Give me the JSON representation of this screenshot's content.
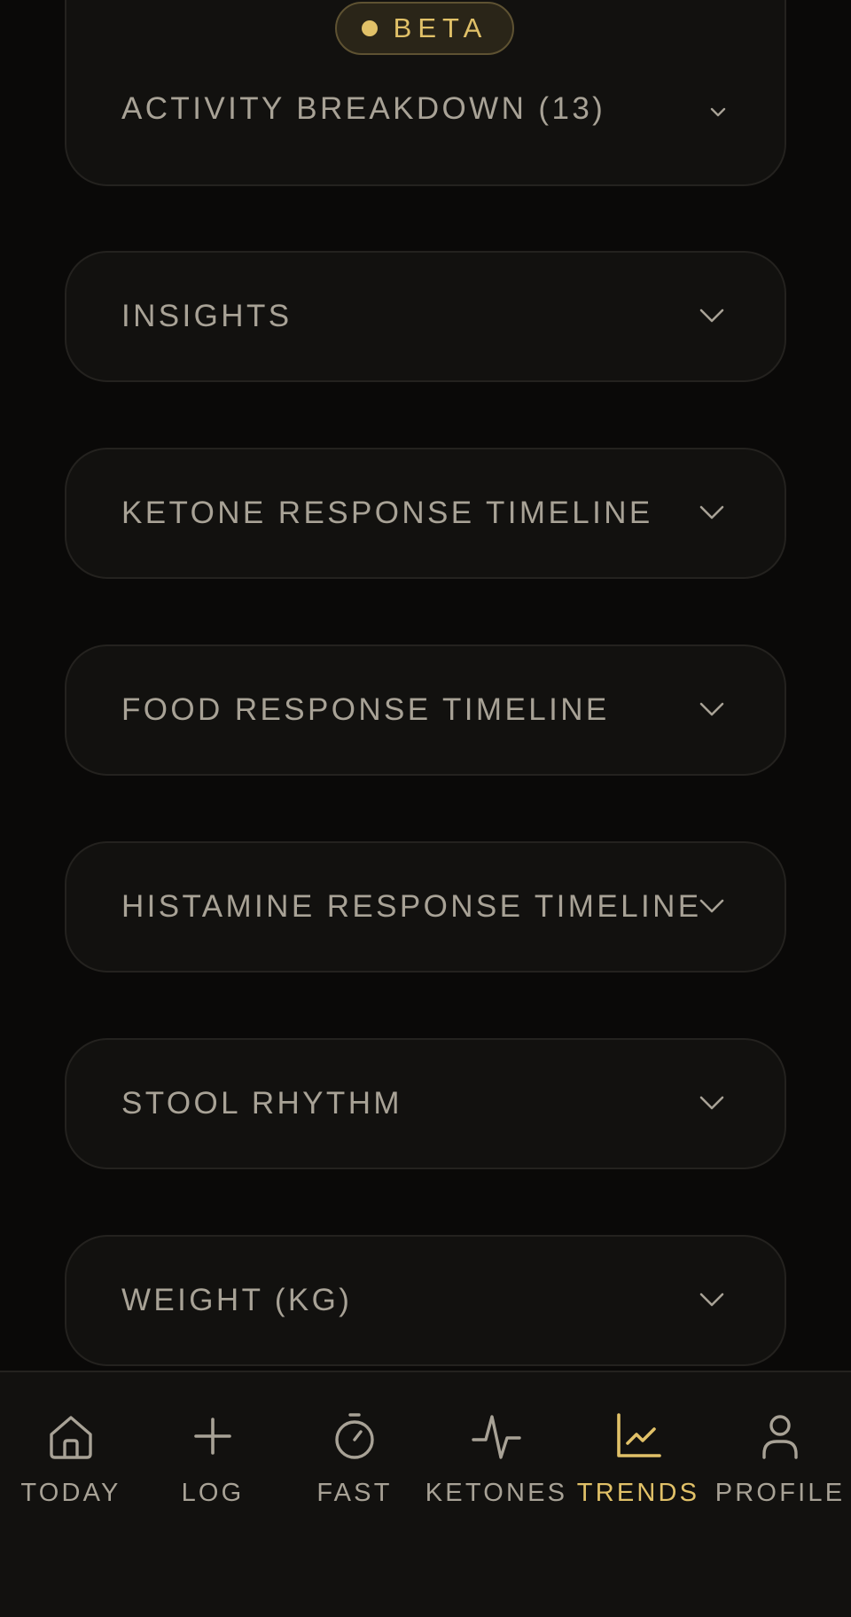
{
  "badge": {
    "label": "BETA"
  },
  "sections": [
    {
      "title": "ACTIVITY BREAKDOWN (13)"
    },
    {
      "title": "INSIGHTS"
    },
    {
      "title": "KETONE RESPONSE TIMELINE"
    },
    {
      "title": "FOOD RESPONSE TIMELINE"
    },
    {
      "title": "HISTAMINE RESPONSE TIMELINE"
    },
    {
      "title": "STOOL RHYTHM"
    },
    {
      "title": "WEIGHT (KG)"
    }
  ],
  "nav": {
    "active": "trends",
    "items": [
      {
        "id": "today",
        "label": "TODAY",
        "icon": "home-icon"
      },
      {
        "id": "log",
        "label": "LOG",
        "icon": "plus-icon"
      },
      {
        "id": "fast",
        "label": "FAST",
        "icon": "stopwatch-icon"
      },
      {
        "id": "ketones",
        "label": "KETONES",
        "icon": "pulse-icon"
      },
      {
        "id": "trends",
        "label": "TRENDS",
        "icon": "chart-icon"
      },
      {
        "id": "profile",
        "label": "PROFILE",
        "icon": "user-icon"
      }
    ]
  },
  "colors": {
    "background": "#0a0908",
    "card": "#12110f",
    "text": "#a8a296",
    "accent": "#e1c168"
  }
}
